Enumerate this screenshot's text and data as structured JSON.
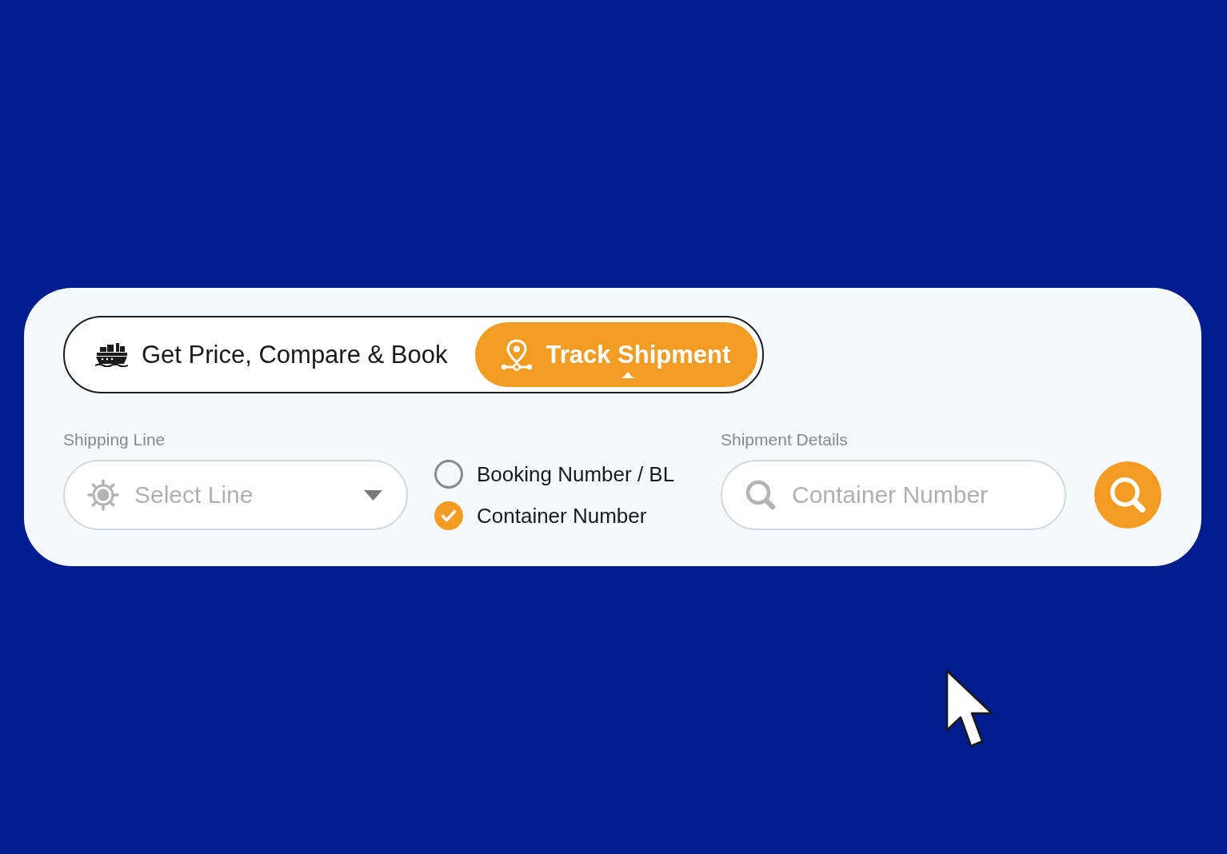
{
  "tabs": [
    {
      "label": "Get Price, Compare & Book",
      "selected": false,
      "kind": "ship"
    },
    {
      "label": "Track Shipment",
      "selected": true,
      "kind": "route"
    }
  ],
  "shipping_line": {
    "label": "Shipping Line",
    "placeholder": "Select Line"
  },
  "search_by": [
    {
      "label": "Booking Number / BL",
      "selected": false
    },
    {
      "label": "Container Number",
      "selected": true
    }
  ],
  "shipment_details": {
    "label": "Shipment Details",
    "placeholder": "Container Number"
  }
}
